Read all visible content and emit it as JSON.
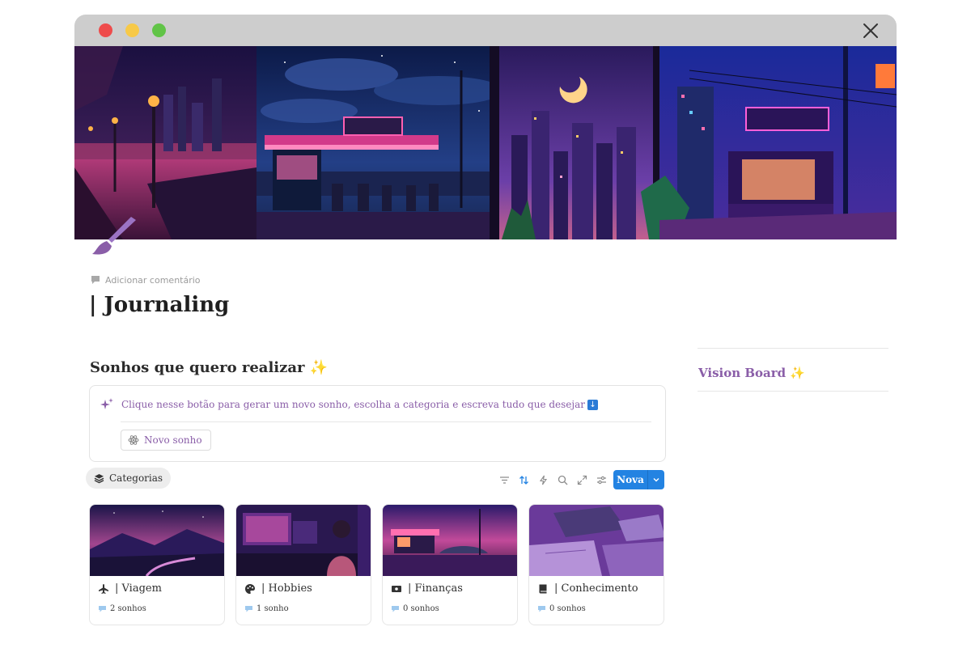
{
  "window": {
    "controls": [
      "close",
      "minimize",
      "maximize"
    ]
  },
  "page": {
    "add_comment": "Adicionar comentário",
    "title": "| Journaling"
  },
  "dreams": {
    "heading": "Sonhos que quero realizar ✨",
    "callout_text": "Clique nesse botão para gerar um novo sonho, escolha a categoria e escreva tudo que desejar",
    "new_dream_button": "Novo sonho"
  },
  "database": {
    "view_tab": "Categorias",
    "new_button": "Nova",
    "toolbar_icons": [
      "filter-icon",
      "sort-icon",
      "automation-icon",
      "search-icon",
      "expand-icon",
      "settings-icon"
    ],
    "cards": [
      {
        "title": "| Viagem",
        "icon": "airplane-icon",
        "count": "2 sonhos"
      },
      {
        "title": "| Hobbies",
        "icon": "palette-icon",
        "count": "1 sonho"
      },
      {
        "title": "| Finanças",
        "icon": "money-icon",
        "count": "0 sonhos"
      },
      {
        "title": "| Conhecimento",
        "icon": "book-icon",
        "count": "0 sonhos"
      }
    ]
  },
  "sidebar": {
    "vision_board": "Vision Board ✨"
  },
  "colors": {
    "accent_purple": "#8a5ea8",
    "primary_blue": "#2383e2",
    "titlebar_gray": "#cdcdcd"
  }
}
